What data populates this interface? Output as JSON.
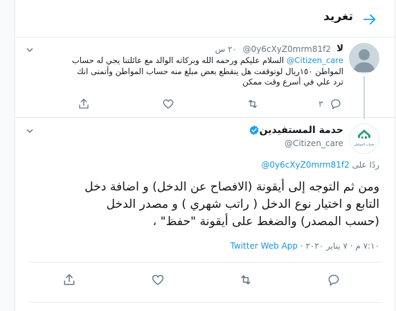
{
  "header": {
    "title": "تغريد"
  },
  "reply_tweet": {
    "name": "لا",
    "handle": "@0y6cXyZ0mrm81f2",
    "time": "٢٠ س",
    "mention": "@Citizen_care",
    "text_line1": "السلام عليكم ورحمه الله وبركاته الوالد مع عائلتنا يجي له حساب",
    "text_line2": "المواطن ١٥٠ريال  لوتوقفت هل ينقطع بعض  مبلغ منه حساب المواطن وأتمنى انك",
    "text_line3": "ترد علي في أسرع وقت ممكن",
    "reply_count": "٣"
  },
  "main_tweet": {
    "name": "حدمة المستفيدين",
    "handle": "@Citizen_care",
    "avatar_caption": "حساب المواطن",
    "replying_prefix": "ردًا على",
    "replying_mention": "@0y6cXyZ0mrm81f2",
    "text_line1": "ومن ثم التوجه إلى أيقونة (الافصاح عن الدخل)  و اضافة دخل",
    "text_line2": "التابع و اختيار نوع الدخل ( راتب شهري ) و مصدر الدخل",
    "text_line3": "(حسب المصدر) والضغط على أيقونة \"حفظ\" ،",
    "timestamp": "٧:١٠ م · ٧ يناير ٢٠٢٠ · ",
    "source": "Twitter Web App"
  },
  "colors": {
    "accent": "#1da1f2",
    "verified": "#1da1f2",
    "muted": "#657786"
  }
}
